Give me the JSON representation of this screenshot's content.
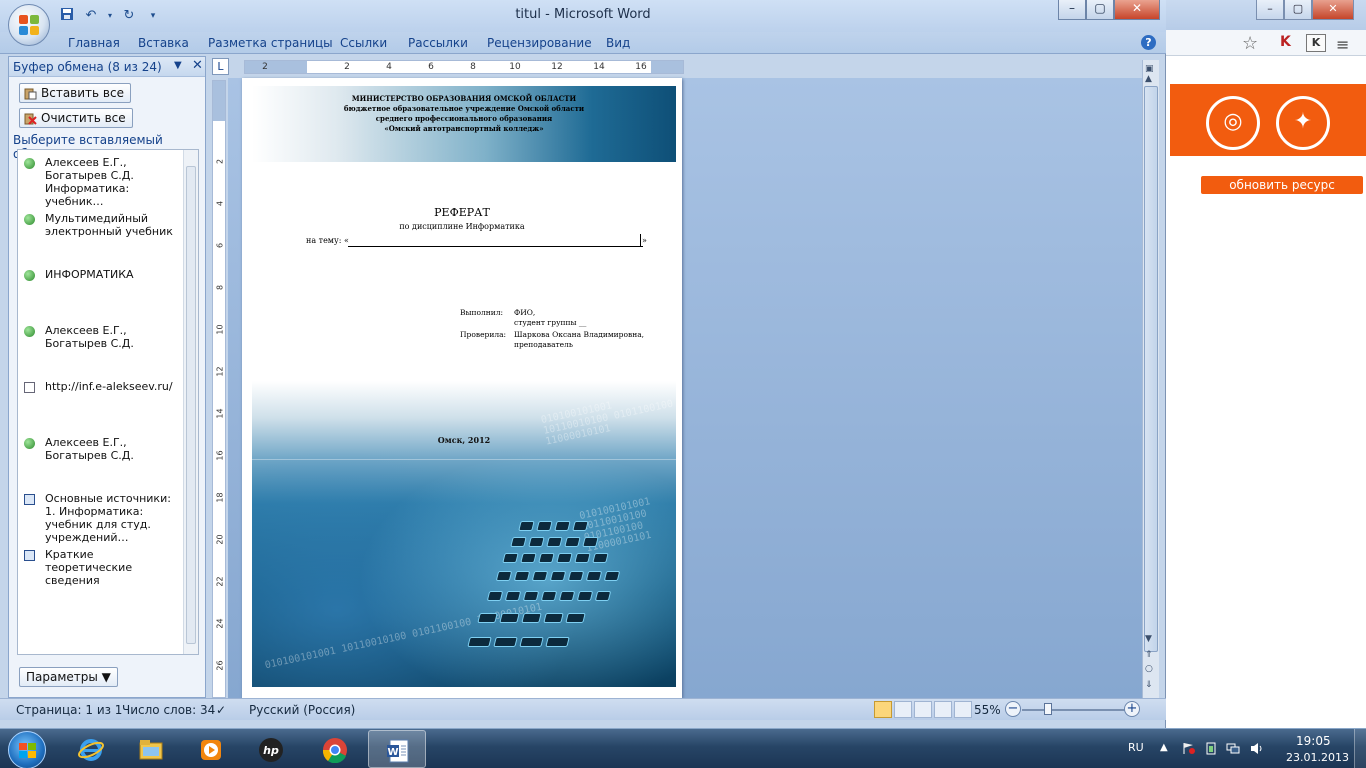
{
  "window": {
    "title": "titul - Microsoft Word",
    "minimize_glyph": "–",
    "maximize_glyph": "▢",
    "close_glyph": "✕"
  },
  "qat": {
    "save_icon": "save-icon",
    "undo_icon": "undo-icon",
    "redo_icon": "redo-icon",
    "customize_icon": "customize-icon"
  },
  "ribbon": {
    "tabs": [
      "Главная",
      "Вставка",
      "Разметка страницы",
      "Ссылки",
      "Рассылки",
      "Рецензирование",
      "Вид"
    ],
    "help_label": "?"
  },
  "clipboard": {
    "title": "Буфер обмена (8 из 24)",
    "paste_all": "Вставить все",
    "clear_all": "Очистить все",
    "prompt": "Выберите вставляемый объект:",
    "items": [
      {
        "type": "globe",
        "text": "Алексеев Е.Г., Богатырев С.Д. Информатика: учебник…"
      },
      {
        "type": "globe",
        "text": "Мультимедийный электронный учебник"
      },
      {
        "type": "globe",
        "text": "ИНФОРМАТИКА"
      },
      {
        "type": "globe",
        "text": "Алексеев Е.Г., Богатырев С.Д."
      },
      {
        "type": "page",
        "text": "http://inf.e-alekseev.ru/"
      },
      {
        "type": "globe",
        "text": "Алексеев Е.Г., Богатырев С.Д."
      },
      {
        "type": "doc",
        "text": "Основные источники: 1. Информатика: учебник для студ. учреждений…"
      },
      {
        "type": "doc",
        "text": "Краткие теоретические сведения"
      }
    ],
    "params": "Параметры ▼"
  },
  "ruler": {
    "corner": "L",
    "h_ticks": [
      "2",
      "2",
      "4",
      "6",
      "8",
      "10",
      "12",
      "14",
      "16"
    ],
    "v_ticks": [
      "2",
      "4",
      "6",
      "8",
      "10",
      "12",
      "14",
      "16",
      "18",
      "20",
      "22",
      "24",
      "26"
    ]
  },
  "document": {
    "header": {
      "line1": "МИНИСТЕРСТВО ОБРАЗОВАНИЯ ОМСКОЙ ОБЛАСТИ",
      "line2": "бюджетное образовательное учреждение Омской области",
      "line3": "среднего профессионального образования",
      "line4": "«Омский автотранспортный колледж»"
    },
    "title": "РЕФЕРАТ",
    "discipline": "по дисциплине  Информатика",
    "topic_prefix": "на тему: «",
    "topic_suffix": "»",
    "performed_label": "Выполнил:",
    "performed_name": "ФИО,",
    "performed_group": "студент группы __",
    "checked_label": "Проверила:",
    "checked_name": "Шаркова Оксана Владимировна,",
    "checked_role": "преподаватель",
    "city": "Омск, 2012",
    "binary_text": "010100101001 10110010100 0101100100 11000010101"
  },
  "status": {
    "page": "Страница: 1 из 1",
    "words": "Число слов: 34",
    "language": "Русский (Россия)",
    "zoom": "55%"
  },
  "browser": {
    "star_icon": "star-icon",
    "kaspersky_label": "K",
    "refresh_label": "обновить ресурс",
    "menu_glyph": "≡"
  },
  "taskbar": {
    "apps": [
      "internet-explorer-icon",
      "windows-explorer-icon",
      "media-player-icon",
      "hp-icon",
      "chrome-icon",
      "word-icon"
    ],
    "lang": "RU",
    "time": "19:05",
    "date": "23.01.2013"
  },
  "colors": {
    "word_chrome": "#c4d5ea",
    "accent_orange": "#f25c0f",
    "taskbar": "#274566"
  }
}
